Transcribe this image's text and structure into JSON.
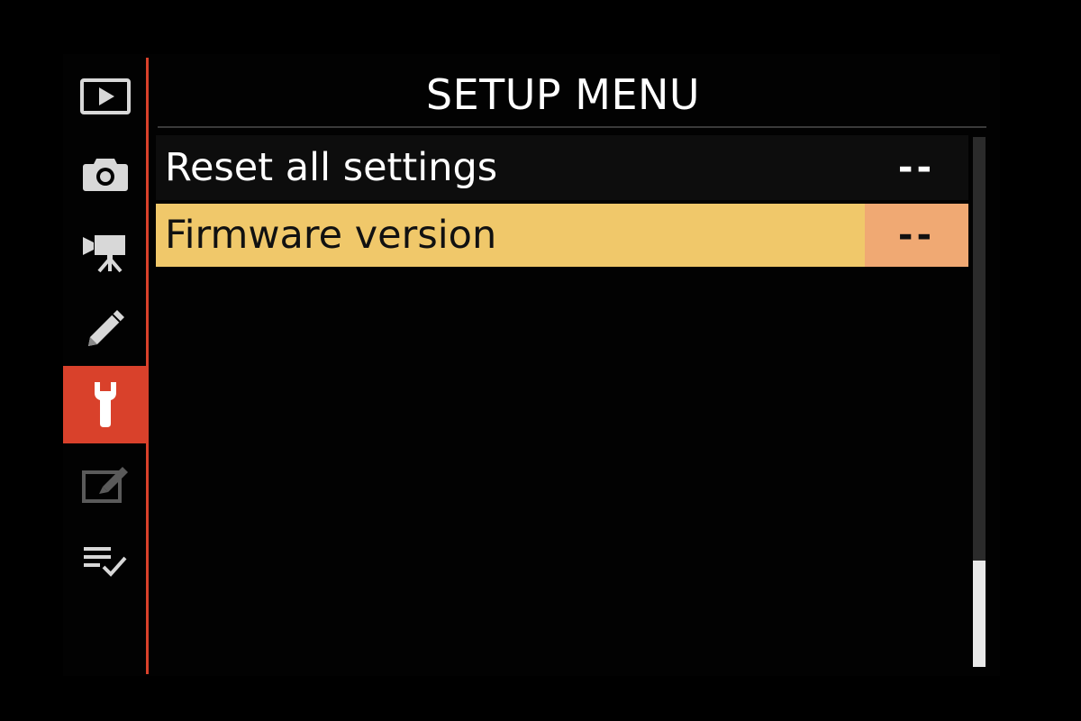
{
  "menu": {
    "title": "SETUP MENU",
    "items": [
      {
        "label": "Reset all settings",
        "value": "--",
        "selected": false
      },
      {
        "label": "Firmware version",
        "value": "--",
        "selected": true
      }
    ]
  },
  "tabs": [
    {
      "icon": "playback-icon",
      "active": false
    },
    {
      "icon": "camera-icon",
      "active": false
    },
    {
      "icon": "movie-camera-icon",
      "active": false
    },
    {
      "icon": "pencil-icon",
      "active": false
    },
    {
      "icon": "wrench-icon",
      "active": true
    },
    {
      "icon": "retouch-icon",
      "active": false
    },
    {
      "icon": "my-menu-icon",
      "active": false
    }
  ],
  "colors": {
    "accent": "#d9412b",
    "highlight_row": "#f0c86a",
    "highlight_value": "#f0a973"
  },
  "scrollbar": {
    "thumb_fraction": 0.2
  }
}
